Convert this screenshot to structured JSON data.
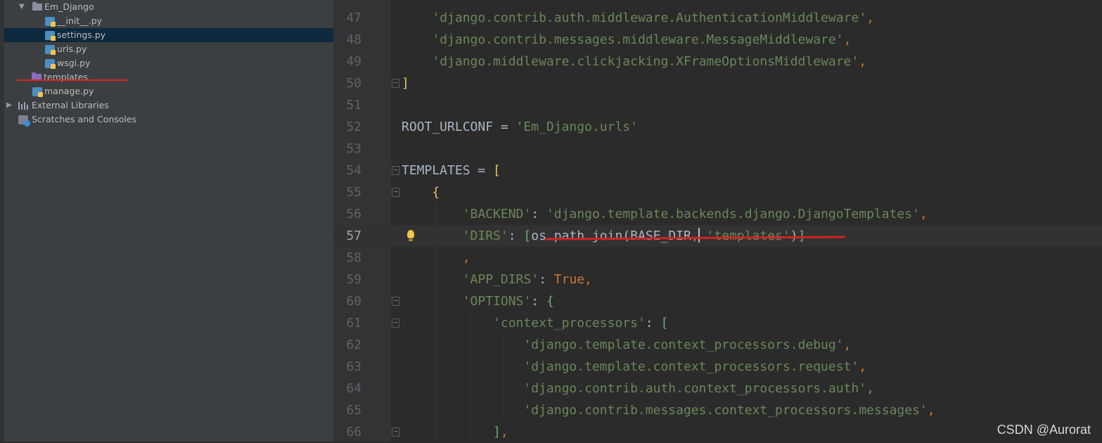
{
  "project_tree": {
    "items": [
      {
        "label": "Em_Django",
        "type": "folder",
        "expanded": true
      },
      {
        "label": "__init__.py",
        "type": "python-file"
      },
      {
        "label": "settings.py",
        "type": "python-file",
        "selected": true
      },
      {
        "label": "urls.py",
        "type": "python-file"
      },
      {
        "label": "wsgi.py",
        "type": "python-file"
      },
      {
        "label": "templates",
        "type": "folder",
        "color": "#8a6dbf"
      },
      {
        "label": "manage.py",
        "type": "python-file"
      },
      {
        "label": "External Libraries",
        "type": "libraries",
        "expanded": false
      },
      {
        "label": "Scratches and Consoles",
        "type": "scratches"
      }
    ]
  },
  "editor": {
    "current_line": 57,
    "lines": [
      {
        "num": "47",
        "code": "    'django.contrib.auth.middleware.AuthenticationMiddleware',"
      },
      {
        "num": "48",
        "code": "    'django.contrib.messages.middleware.MessageMiddleware',"
      },
      {
        "num": "49",
        "code": "    'django.middleware.clickjacking.XFrameOptionsMiddleware',"
      },
      {
        "num": "50",
        "code": "]"
      },
      {
        "num": "51",
        "code": ""
      },
      {
        "num": "52",
        "code": "ROOT_URLCONF = 'Em_Django.urls'"
      },
      {
        "num": "53",
        "code": ""
      },
      {
        "num": "54",
        "code": "TEMPLATES = ["
      },
      {
        "num": "55",
        "code": "    {"
      },
      {
        "num": "56",
        "code": "        'BACKEND': 'django.template.backends.django.DjangoTemplates',"
      },
      {
        "num": "57",
        "code": "        'DIRS': [os.path.join(BASE_DIR, 'templates')]"
      },
      {
        "num": "58",
        "code": "        ,"
      },
      {
        "num": "59",
        "code": "        'APP_DIRS': True,"
      },
      {
        "num": "60",
        "code": "        'OPTIONS': {"
      },
      {
        "num": "61",
        "code": "            'context_processors': ["
      },
      {
        "num": "62",
        "code": "                'django.template.context_processors.debug',"
      },
      {
        "num": "63",
        "code": "                'django.template.context_processors.request',"
      },
      {
        "num": "64",
        "code": "                'django.contrib.auth.context_processors.auth',"
      },
      {
        "num": "65",
        "code": "                'django.contrib.messages.context_processors.messages',"
      },
      {
        "num": "66",
        "code": "            ],"
      }
    ]
  },
  "watermark": "CSDN @Aurorat",
  "colors": {
    "tree_bg": "#3c3f41",
    "selected_row": "#0d293e",
    "editor_bg": "#2b2b2b",
    "string": "#6a8759",
    "keyword": "#cc7832",
    "annotation_red": "#e02525"
  }
}
